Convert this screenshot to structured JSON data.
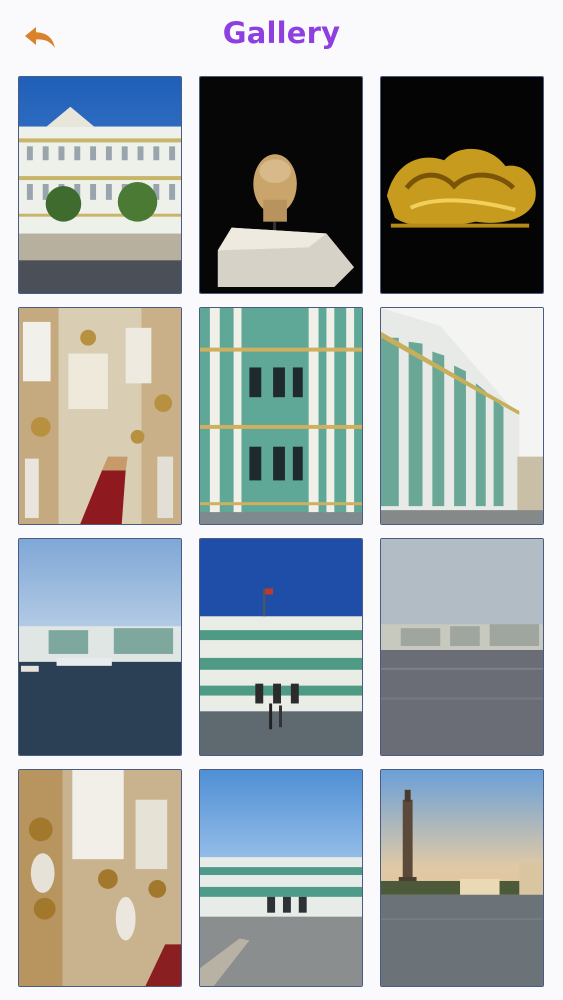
{
  "header": {
    "title": "Gallery",
    "back_icon": "back-arrow-icon",
    "accent_color": "#8e3fe0",
    "back_color": "#d9822b"
  },
  "gallery": {
    "photos": [
      {
        "subject": "winter-palace-facade-river"
      },
      {
        "subject": "stone-head-bust"
      },
      {
        "subject": "gold-animal-artifact"
      },
      {
        "subject": "jordan-staircase-interior"
      },
      {
        "subject": "green-palace-facade-closeup"
      },
      {
        "subject": "palace-facade-angle"
      },
      {
        "subject": "palace-across-river"
      },
      {
        "subject": "palace-square-blue-sky"
      },
      {
        "subject": "river-embankment-evening"
      },
      {
        "subject": "gilded-interior-statues"
      },
      {
        "subject": "palace-square-wide"
      },
      {
        "subject": "alexander-column-sunset"
      }
    ]
  }
}
